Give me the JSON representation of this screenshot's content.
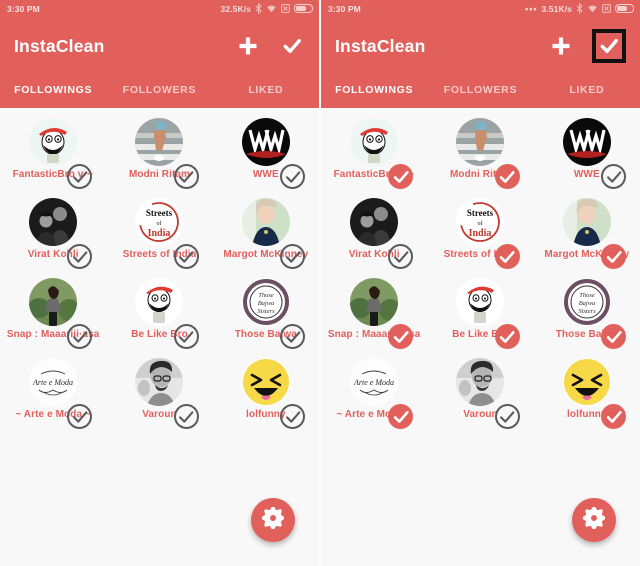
{
  "app": {
    "name": "InstaClean",
    "accent_color": "#E2605C",
    "background_color": "#F8F8F8",
    "label_color": "#E2605C"
  },
  "panels": [
    {
      "id": "before",
      "status_bar": {
        "time": "3:30 PM",
        "leading_dots": "",
        "network_speed": "32.5K/s",
        "icons": [
          "bluetooth-icon",
          "wifi-icon",
          "no-sim-icon",
          "battery-icon"
        ]
      },
      "appbar": {
        "title": "InstaClean",
        "add_label": "+",
        "select_all_label": "✓",
        "select_all_highlighted": false
      },
      "tabs": [
        {
          "label": "FOLLOWINGS",
          "active": true
        },
        {
          "label": "FOLLOWERS",
          "active": false
        },
        {
          "label": "LIKED",
          "active": false
        }
      ],
      "items": [
        {
          "name": "FantasticBro v···",
          "avatar": "cartoon-cap-face-avatar",
          "selected": false
        },
        {
          "name": "Modni Ritam",
          "avatar": "legs-stairs-photo-avatar",
          "selected": false
        },
        {
          "name": "WWE",
          "avatar": "wwe-logo-avatar",
          "selected": false
        },
        {
          "name": "Virat Kohli",
          "avatar": "couple-bw-photo-avatar",
          "selected": false
        },
        {
          "name": "Streets of India",
          "avatar": "streets-of-india-logo-avatar",
          "selected": false
        },
        {
          "name": "Margot McKinney",
          "avatar": "woman-portrait-photo-avatar",
          "selected": false
        },
        {
          "name": "Snap : Maaariii·asa",
          "avatar": "woman-garden-photo-avatar",
          "selected": false
        },
        {
          "name": "Be Like Bro",
          "avatar": "be-like-bro-avatar",
          "selected": false
        },
        {
          "name": "Those Bajwa",
          "avatar": "those-bajwa-sisters-logo-avatar",
          "selected": false
        },
        {
          "name": "~ Arte e Moda ~",
          "avatar": "arte-e-moda-logo-avatar",
          "selected": false
        },
        {
          "name": "Varoun",
          "avatar": "man-bw-photo-avatar",
          "selected": false
        },
        {
          "name": "lolfunny",
          "avatar": "laughing-emoji-avatar",
          "selected": false
        }
      ],
      "fab": {
        "icon": "gear-icon"
      }
    },
    {
      "id": "after",
      "status_bar": {
        "time": "3:30 PM",
        "leading_dots": "•••",
        "network_speed": "3.51K/s",
        "icons": [
          "bluetooth-icon",
          "wifi-icon",
          "no-sim-icon",
          "battery-icon"
        ]
      },
      "appbar": {
        "title": "InstaClean",
        "add_label": "+",
        "select_all_label": "✓",
        "select_all_highlighted": true
      },
      "tabs": [
        {
          "label": "FOLLOWINGS",
          "active": true
        },
        {
          "label": "FOLLOWERS",
          "active": false
        },
        {
          "label": "LIKED",
          "active": false
        }
      ],
      "items": [
        {
          "name": "FantasticBro v···",
          "avatar": "cartoon-cap-face-avatar",
          "selected": true
        },
        {
          "name": "Modni Ritam",
          "avatar": "legs-stairs-photo-avatar",
          "selected": true
        },
        {
          "name": "WWE",
          "avatar": "wwe-logo-avatar",
          "selected": false
        },
        {
          "name": "Virat Kohli",
          "avatar": "couple-bw-photo-avatar",
          "selected": false
        },
        {
          "name": "Streets of India",
          "avatar": "streets-of-india-logo-avatar",
          "selected": true
        },
        {
          "name": "Margot McKinney",
          "avatar": "woman-portrait-photo-avatar",
          "selected": true
        },
        {
          "name": "Snap : Maaariii·asa",
          "avatar": "woman-garden-photo-avatar",
          "selected": true
        },
        {
          "name": "Be Like Bro",
          "avatar": "be-like-bro-avatar",
          "selected": true
        },
        {
          "name": "Those Bajwa",
          "avatar": "those-bajwa-sisters-logo-avatar",
          "selected": true
        },
        {
          "name": "~ Arte e Moda ~",
          "avatar": "arte-e-moda-logo-avatar",
          "selected": true
        },
        {
          "name": "Varoun",
          "avatar": "man-bw-photo-avatar",
          "selected": false
        },
        {
          "name": "lolfunny",
          "avatar": "laughing-emoji-avatar",
          "selected": true
        }
      ],
      "fab": {
        "icon": "gear-icon"
      }
    }
  ]
}
